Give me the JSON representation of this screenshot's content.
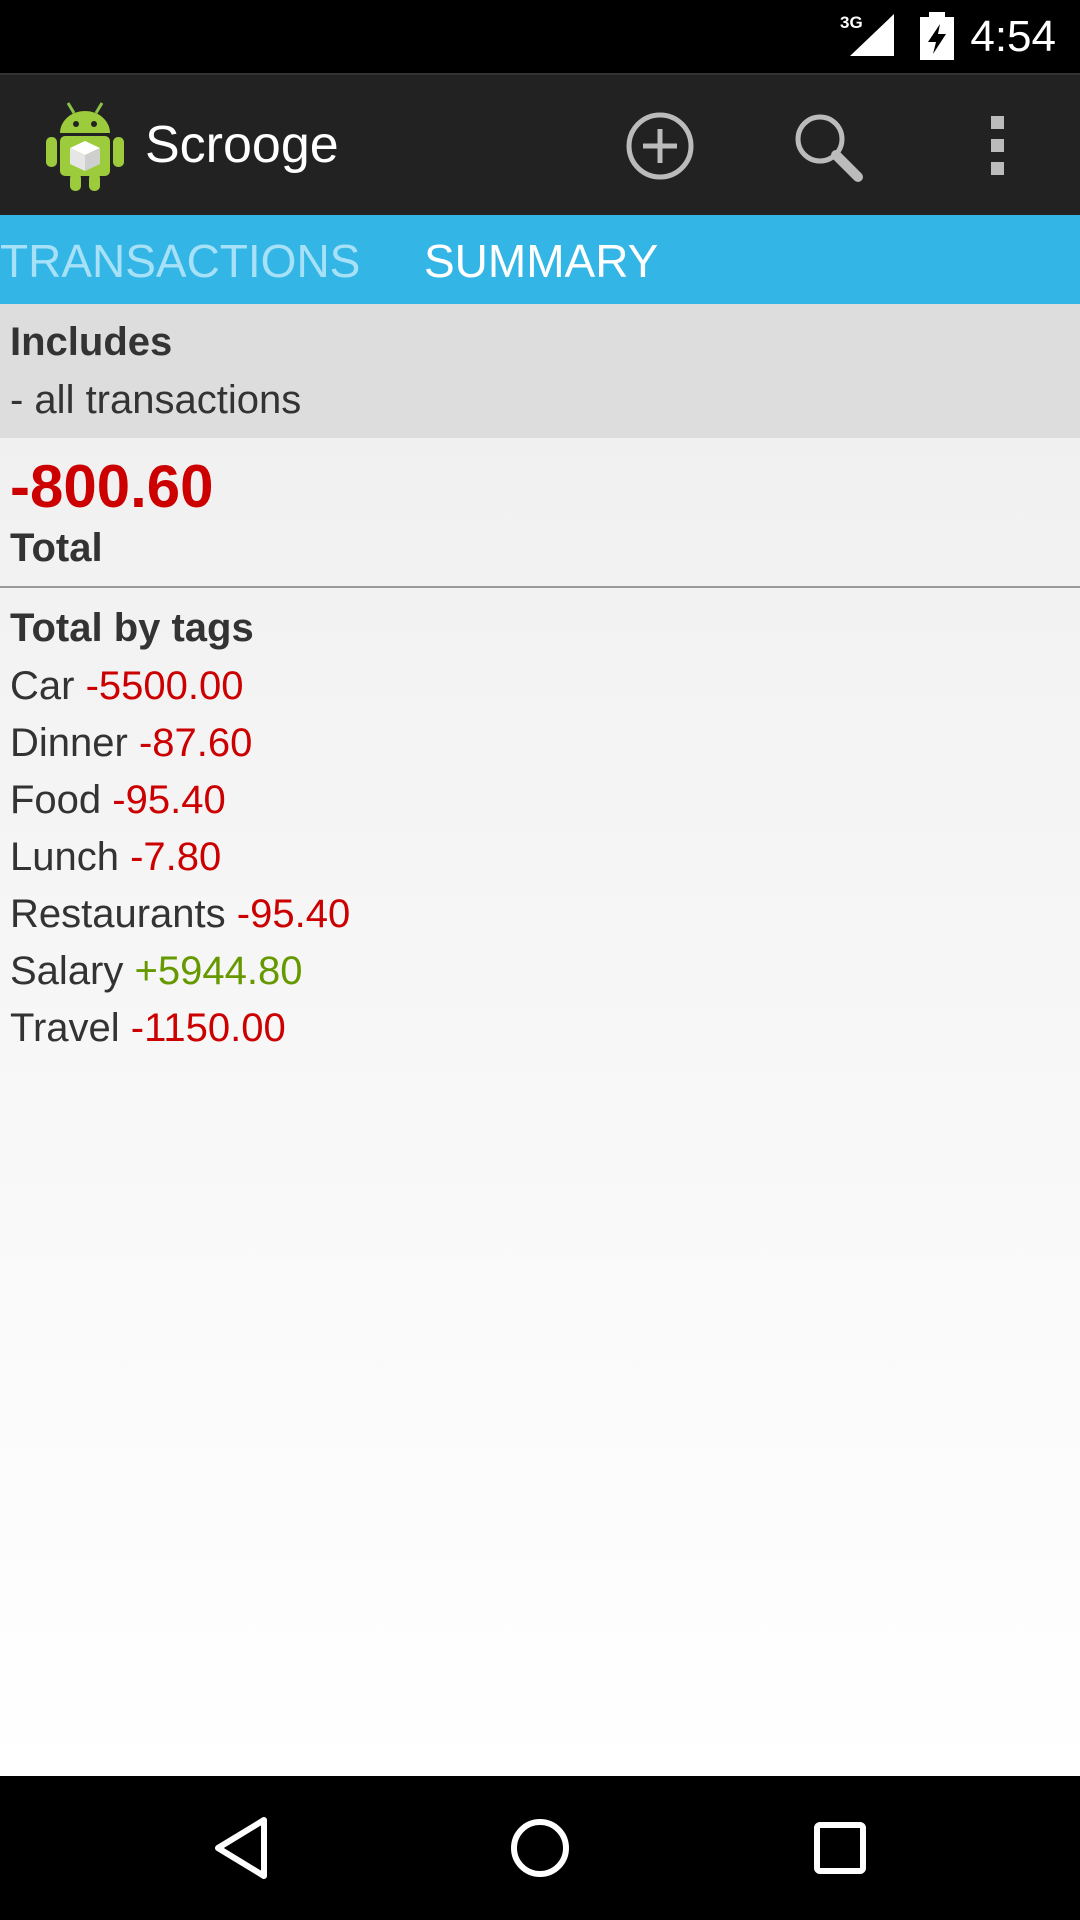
{
  "status_bar": {
    "network": "3G",
    "time": "4:54"
  },
  "action_bar": {
    "title": "Scrooge",
    "icons": [
      "app-icon",
      "add-icon",
      "search-icon",
      "overflow-menu-icon"
    ]
  },
  "tabs": {
    "items": [
      {
        "label": "TRANSACTIONS",
        "active": false
      },
      {
        "label": "SUMMARY",
        "active": true
      }
    ]
  },
  "summary": {
    "includes_label": "Includes",
    "includes_value": "- all transactions",
    "total_value": "-800.60",
    "total_label": "Total",
    "tags_heading": "Total by tags",
    "tags": [
      {
        "name": "Car",
        "amount": "-5500.00"
      },
      {
        "name": "Dinner",
        "amount": "-87.60"
      },
      {
        "name": "Food",
        "amount": "-95.40"
      },
      {
        "name": "Lunch",
        "amount": "-7.80"
      },
      {
        "name": "Restaurants",
        "amount": "-95.40"
      },
      {
        "name": "Salary",
        "amount": "+5944.80"
      },
      {
        "name": "Travel",
        "amount": "-1150.00"
      }
    ]
  },
  "colors": {
    "tab_bar": "#33b5e5",
    "negative": "#cc0000",
    "positive": "#669900",
    "action_bar": "#222222"
  },
  "nav_bar": {
    "icons": [
      "back-icon",
      "home-icon",
      "recents-icon"
    ]
  }
}
